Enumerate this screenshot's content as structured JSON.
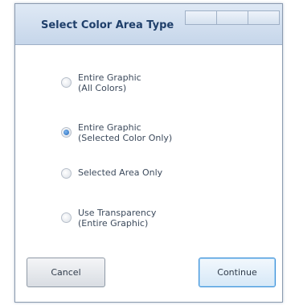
{
  "window": {
    "title": "Select Color Area Type"
  },
  "options": [
    {
      "line1": "Entire Graphic",
      "line2": "(All Colors)",
      "checked": false
    },
    {
      "line1": "Entire Graphic",
      "line2": "(Selected Color Only)",
      "checked": true
    },
    {
      "line1": "Selected Area Only",
      "line2": "",
      "checked": false
    },
    {
      "line1": "Use Transparency",
      "line2": "(Entire Graphic)",
      "checked": false
    }
  ],
  "buttons": {
    "cancel_label": "Cancel",
    "continue_label": "Continue"
  },
  "colors": {
    "title_text": "#1f3f6a",
    "accent": "#2166b6",
    "default_button_border": "#3c8fd6"
  }
}
